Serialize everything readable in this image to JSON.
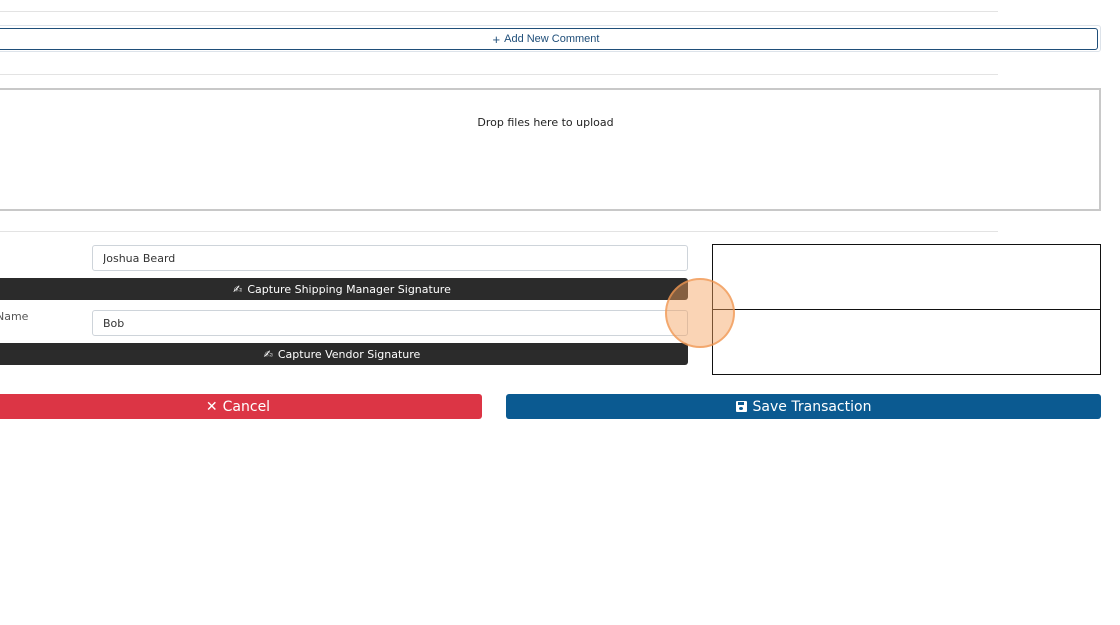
{
  "comments": {
    "add_label": "Add New Comment",
    "add_icon": "plus-icon"
  },
  "upload": {
    "dropzone_text": "Drop files here to upload"
  },
  "shipping_manager": {
    "label_fragment": ":",
    "name_value": "Joshua Beard",
    "capture_label": "Capture Shipping Manager Signature",
    "capture_icon": "signature-icon"
  },
  "vendor": {
    "label_fragment": "Name",
    "name_value": "Bob",
    "capture_label": "Capture Vendor Signature",
    "capture_icon": "signature-icon"
  },
  "actions": {
    "cancel_label": "Cancel",
    "cancel_icon": "close-icon",
    "cancel_color": "#dc3545",
    "save_label": "Save Transaction",
    "save_icon": "floppy-disk-icon",
    "save_color": "#0b5a91"
  }
}
